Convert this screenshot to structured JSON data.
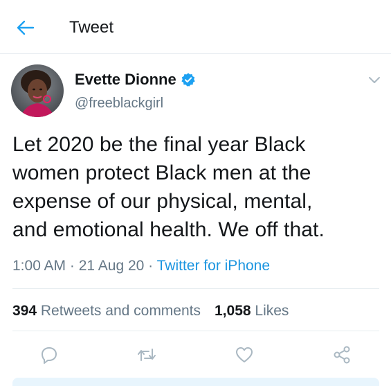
{
  "header": {
    "title": "Tweet",
    "back_icon": "arrow-left-icon"
  },
  "tweet": {
    "author": {
      "name": "Evette Dionne",
      "handle": "@freeblackgirl",
      "verified": true
    },
    "text": "Let 2020 be the final year Black\nwomen protect Black men at the\nexpense of our physical, mental,\nand emotional health. We off that.",
    "time": "1:00 AM",
    "separator": " · ",
    "date": "21 Aug 20",
    "source": "Twitter for iPhone",
    "stats": {
      "retweets_count": "394",
      "retweets_label": "Retweets and comments",
      "likes_count": "1,058",
      "likes_label": "Likes"
    }
  },
  "colors": {
    "accent": "#1b95e0",
    "verified": "#1da1f2",
    "secondary_text": "#657786",
    "primary_text": "#14171a",
    "divider": "#e6ecf0"
  },
  "actions": [
    {
      "icon": "reply-icon"
    },
    {
      "icon": "retweet-icon"
    },
    {
      "icon": "like-icon"
    },
    {
      "icon": "share-icon"
    }
  ]
}
